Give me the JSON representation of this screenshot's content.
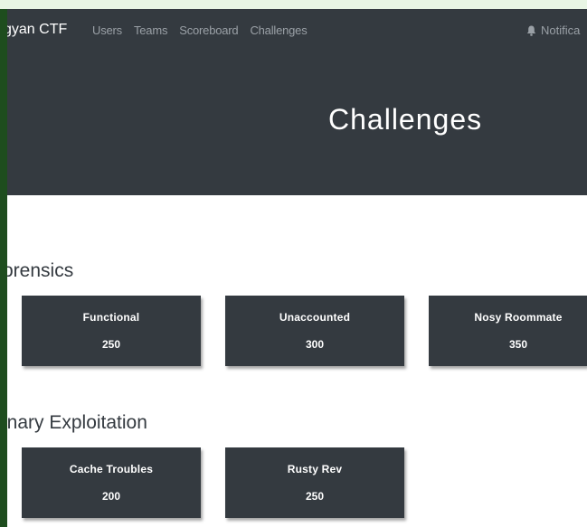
{
  "navbar": {
    "brand": "gyan CTF",
    "links": [
      "Users",
      "Teams",
      "Scoreboard",
      "Challenges"
    ],
    "notifications_label": "Notifica",
    "bg_color": "#343a40"
  },
  "jumbotron": {
    "title": "Challenges"
  },
  "categories": [
    {
      "name": "orensics",
      "challenges": [
        {
          "name": "Functional",
          "value": "250"
        },
        {
          "name": "Unaccounted",
          "value": "300"
        },
        {
          "name": "Nosy Roommate",
          "value": "350"
        }
      ]
    },
    {
      "name": "inary Exploitation",
      "challenges": [
        {
          "name": "Cache Troubles",
          "value": "200"
        },
        {
          "name": "Rusty Rev",
          "value": "250"
        }
      ]
    }
  ],
  "colors": {
    "dark": "#343a40",
    "outer_border": "#1e4d1e",
    "top_strip": "#e8f5e4"
  }
}
